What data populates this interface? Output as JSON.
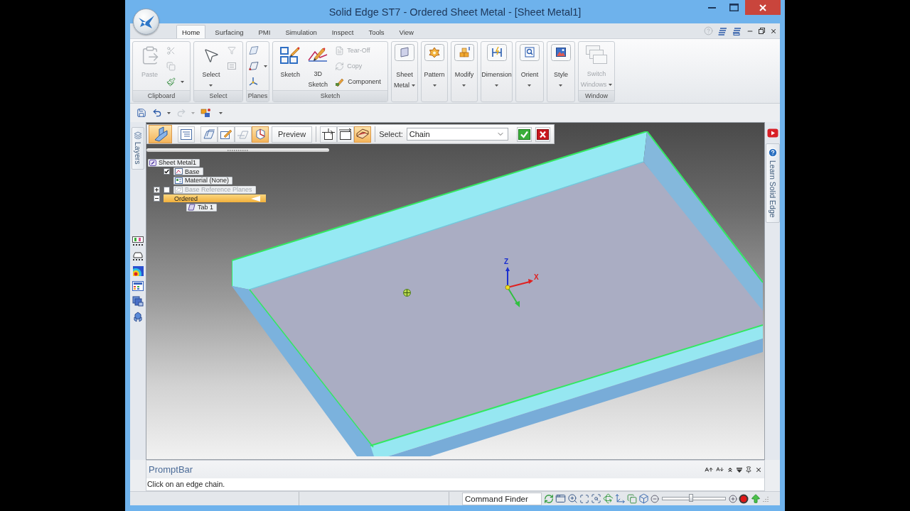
{
  "window": {
    "title": "Solid Edge ST7 - Ordered Sheet Metal - [Sheet Metal1]"
  },
  "ribbon_tabs": [
    {
      "label": "Home",
      "selected": true
    },
    {
      "label": "Surfacing",
      "selected": false
    },
    {
      "label": "PMI",
      "selected": false
    },
    {
      "label": "Simulation",
      "selected": false
    },
    {
      "label": "Inspect",
      "selected": false
    },
    {
      "label": "Tools",
      "selected": false
    },
    {
      "label": "View",
      "selected": false
    }
  ],
  "ribbon_groups": [
    {
      "label": "Clipboard",
      "items": [
        {
          "kind": "large",
          "label": "Paste",
          "disabled": true,
          "dropdown": false
        },
        {
          "kind": "stack",
          "buttons": [
            {
              "disabled": true,
              "dropdown": false
            },
            {
              "disabled": true,
              "dropdown": false
            },
            {
              "disabled": false,
              "dropdown": true
            }
          ]
        }
      ]
    },
    {
      "label": "Select",
      "items": [
        {
          "kind": "large",
          "label": "Select",
          "disabled": false,
          "dropdown": true
        },
        {
          "kind": "stack",
          "buttons": [
            {
              "disabled": true,
              "dropdown": false
            },
            {
              "disabled": true,
              "dropdown": false
            }
          ]
        }
      ]
    },
    {
      "label": "Planes",
      "items": [
        {
          "kind": "stack",
          "buttons": [
            {
              "disabled": false,
              "dropdown": false
            },
            {
              "disabled": false,
              "dropdown": true
            },
            {
              "disabled": false,
              "dropdown": false
            }
          ]
        }
      ]
    },
    {
      "label": "Sketch",
      "items": [
        {
          "kind": "large",
          "label": "Sketch",
          "disabled": false,
          "dropdown": false
        },
        {
          "kind": "large",
          "label": "3D Sketch",
          "disabled": false,
          "dropdown": false
        },
        {
          "kind": "stack",
          "buttons": [
            {
              "label": "Tear-Off",
              "disabled": true,
              "dropdown": false
            },
            {
              "label": "Copy",
              "disabled": true,
              "dropdown": false
            },
            {
              "label": "Component",
              "disabled": false,
              "dropdown": false
            }
          ]
        }
      ]
    },
    {
      "items": [
        {
          "kind": "menu",
          "label": "Sheet Metal",
          "disabled": false,
          "dropdown": true
        }
      ]
    },
    {
      "items": [
        {
          "kind": "menu",
          "label": "Pattern",
          "disabled": false,
          "dropdown": true
        }
      ]
    },
    {
      "items": [
        {
          "kind": "menu",
          "label": "Modify",
          "disabled": false,
          "dropdown": true
        }
      ]
    },
    {
      "items": [
        {
          "kind": "menu",
          "label": "Dimension",
          "disabled": false,
          "dropdown": true
        }
      ]
    },
    {
      "items": [
        {
          "kind": "menu",
          "label": "Orient",
          "disabled": false,
          "dropdown": true
        }
      ]
    },
    {
      "items": [
        {
          "kind": "menu",
          "label": "Style",
          "disabled": false,
          "dropdown": true
        }
      ]
    },
    {
      "label": "Window",
      "items": [
        {
          "kind": "large",
          "label": "Switch Windows",
          "disabled": true,
          "dropdown": true
        }
      ]
    }
  ],
  "quick_access": [
    {
      "disabled": false,
      "dropdown": false
    },
    {
      "disabled": false,
      "dropdown": true
    },
    {
      "disabled": true,
      "dropdown": true
    },
    {
      "disabled": false,
      "dropdown": false
    }
  ],
  "command_bar": {
    "groups": [
      {
        "buttons": [
          {
            "selected": true
          }
        ]
      },
      {
        "buttons": [
          {
            "selected": false
          }
        ]
      },
      {
        "buttons": [
          {
            "selected": false
          },
          {
            "selected": false
          },
          {
            "selected": false
          },
          {
            "selected": true
          }
        ]
      },
      {
        "buttons": [
          {
            "label": "Preview",
            "selected": false
          }
        ]
      },
      {
        "buttons": [
          {
            "selected": false
          },
          {
            "selected": false
          },
          {
            "selected": true
          }
        ]
      }
    ],
    "select_label": "Select:",
    "select_value": "Chain"
  },
  "pathfinder": {
    "tree": [
      {
        "kind": "root",
        "label": "Sheet Metal1",
        "selected": false,
        "disabled": false,
        "children": [
          {
            "kind": "feature",
            "label": "Base",
            "selected": false,
            "disabled": false,
            "checked": true
          },
          {
            "kind": "feature",
            "label": "Material (None)",
            "selected": false,
            "disabled": false
          },
          {
            "kind": "feature",
            "label": "Base Reference Planes",
            "selected": false,
            "disabled": true,
            "checked": false,
            "expanded": false
          },
          {
            "kind": "group",
            "label": "Ordered",
            "selected": true,
            "disabled": false,
            "expanded": true,
            "children": [
              {
                "kind": "feature",
                "label": "Tab 1",
                "selected": false,
                "disabled": false
              }
            ]
          }
        ]
      }
    ]
  },
  "viewport": {
    "triad_labels": [
      "Z",
      "X"
    ]
  },
  "side_tabs": {
    "left": [
      {
        "label": "Layers"
      }
    ],
    "right": [
      {
        "label": "Learn Solid Edge"
      }
    ]
  },
  "prompt_bar": {
    "title": "PromptBar",
    "message": "Click on an edge chain."
  },
  "status_bar": {
    "command_finder": {
      "placeholder": "Command Finder"
    },
    "zoom": {
      "level": 0.45
    }
  }
}
